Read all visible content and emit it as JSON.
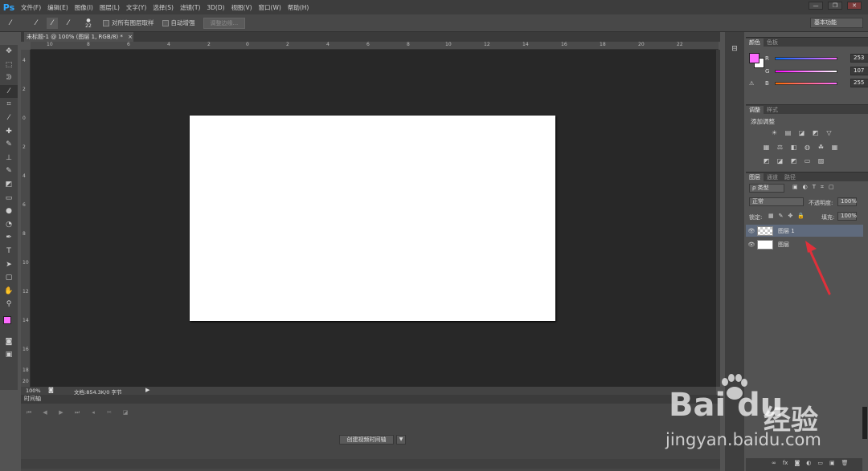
{
  "menubar": {
    "logo": "Ps",
    "items": [
      "文件(F)",
      "编辑(E)",
      "图像(I)",
      "图层(L)",
      "文字(Y)",
      "选择(S)",
      "滤镜(T)",
      "3D(D)",
      "视图(V)",
      "窗口(W)",
      "帮助(H)"
    ]
  },
  "window": {
    "min": "—",
    "restore": "❐",
    "close": "✕"
  },
  "options": {
    "brush_size": "22",
    "sample_all": "对所有图层取样",
    "auto_enhance": "自动增强",
    "refine_edge": "调整边缘...",
    "workspace": "基本功能"
  },
  "document": {
    "tab_title": "未标题-1 @ 100% (图层 1, RGB/8) *",
    "close": "×"
  },
  "ruler_top": [
    "10",
    "8",
    "6",
    "4",
    "2",
    "0",
    "2",
    "4",
    "6",
    "8",
    "10",
    "12",
    "14",
    "16",
    "18",
    "20",
    "22"
  ],
  "ruler_left": [
    "4",
    "2",
    "0",
    "2",
    "4",
    "6",
    "8",
    "10",
    "12",
    "14",
    "16",
    "18",
    "20"
  ],
  "status": {
    "zoom": "100%",
    "doc_info": "文档:854.3K/0 字节"
  },
  "timeline": {
    "title": "时间轴",
    "create_button": "创建视频时间轴"
  },
  "color_panel": {
    "tabs": [
      "颜色",
      "色板"
    ],
    "r_label": "R",
    "g_label": "G",
    "b_label": "B",
    "r": "253",
    "g": "107",
    "b": "255",
    "fg": "#fd6bff"
  },
  "adjust_panel": {
    "tabs": [
      "调整",
      "样式"
    ],
    "title": "添加调整"
  },
  "layers_panel": {
    "tabs": [
      "图层",
      "通道",
      "路径"
    ],
    "kind": "ρ 类型",
    "blend": "正常",
    "opacity_label": "不透明度:",
    "opacity": "100%",
    "lock_label": "锁定:",
    "fill_label": "填充:",
    "fill": "100%",
    "layers": [
      {
        "name": "图层 1"
      },
      {
        "name": "图层"
      }
    ]
  },
  "watermark": {
    "logo": "Bai du",
    "brand": "经验",
    "url": "jingyan.baidu.com"
  }
}
